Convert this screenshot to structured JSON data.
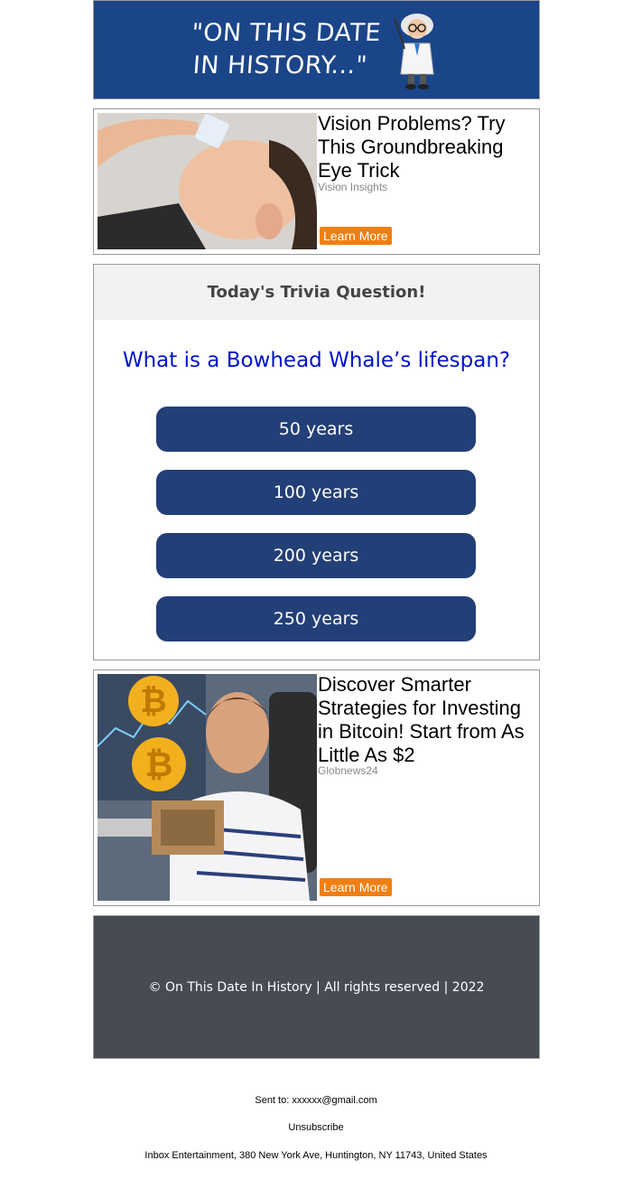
{
  "header": {
    "logo_line1": "\"ON THIS DATE",
    "logo_line2": "IN HISTORY...\""
  },
  "ad1": {
    "title": "Vision Problems? Try This Groundbreaking Eye Trick",
    "source": "Vision Insights",
    "cta": "Learn More"
  },
  "trivia": {
    "heading": "Today's Trivia Question!",
    "question": "What is a Bowhead Whale’s lifespan?",
    "answers": [
      "50 years",
      "100 years",
      "200 years",
      "250 years"
    ]
  },
  "ad2": {
    "title": "Discover Smarter Strategies for Investing in Bitcoin! Start from As Little As $2",
    "source": "Globnews24",
    "cta": "Learn More"
  },
  "footer": {
    "copyright": "© On This Date In History | All rights reserved | 2022"
  },
  "meta": {
    "sent_to": "Sent to: xxxxxx@gmail.com",
    "unsubscribe": "Unsubscribe",
    "address": "Inbox Entertainment, 380 New York Ave, Huntington, NY 11743, United States"
  },
  "colors": {
    "header_bg": "#1b4589",
    "answer_bg": "#233f78",
    "question_text": "#0014c8",
    "cta_bg": "#f07f12",
    "footer_bg": "#464b54"
  }
}
